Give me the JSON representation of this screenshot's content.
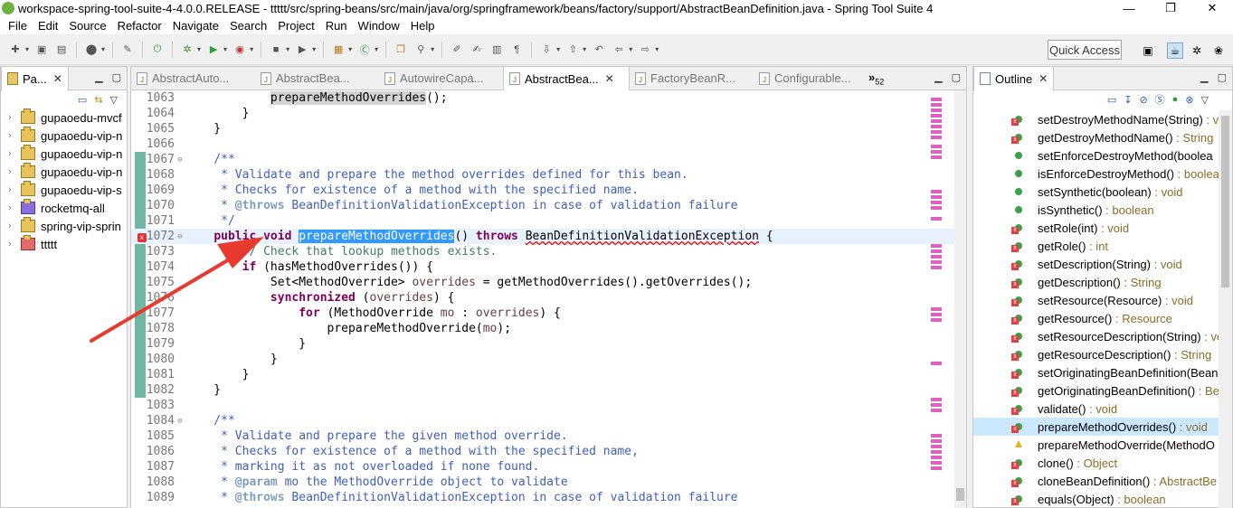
{
  "window": {
    "title": "workspace-spring-tool-suite-4-4.0.0.RELEASE - ttttt/src/spring-beans/src/main/java/org/springframework/beans/factory/support/AbstractBeanDefinition.java - Spring Tool Suite 4",
    "minimize": "—",
    "restore": "❐",
    "close": "✕"
  },
  "menu": [
    "File",
    "Edit",
    "Source",
    "Refactor",
    "Navigate",
    "Search",
    "Project",
    "Run",
    "Window",
    "Help"
  ],
  "toolbar": {
    "quick_access": "Quick Access"
  },
  "package_explorer": {
    "tab_label": "Pa...",
    "projects": [
      "gupaoedu-mvcf",
      "gupaoedu-vip-n",
      "gupaoedu-vip-n",
      "gupaoedu-vip-n",
      "gupaoedu-vip-s",
      "rocketmq-all",
      "spring-vip-sprin",
      "ttttt"
    ]
  },
  "editor": {
    "tabs": [
      {
        "label": "AbstractAuto...",
        "active": false
      },
      {
        "label": "AbstractBea...",
        "active": false
      },
      {
        "label": "AutowireCapa...",
        "active": false
      },
      {
        "label": "AbstractBea...",
        "active": true
      },
      {
        "label": "FactoryBeanR...",
        "active": false
      },
      {
        "label": "Configurable...",
        "active": false
      }
    ],
    "overflow_count": "52",
    "lines": [
      {
        "n": "1063",
        "text": "            prepareMethodOverrides();"
      },
      {
        "n": "1064",
        "text": "        }"
      },
      {
        "n": "1065",
        "text": "    }"
      },
      {
        "n": "1066",
        "text": ""
      },
      {
        "n": "1067",
        "text": "    /**"
      },
      {
        "n": "1068",
        "text": "     * Validate and prepare the method overrides defined for this bean."
      },
      {
        "n": "1069",
        "text": "     * Checks for existence of a method with the specified name."
      },
      {
        "n": "1070",
        "text": "     * @throws BeanDefinitionValidationException in case of validation failure"
      },
      {
        "n": "1071",
        "text": "     */"
      },
      {
        "n": "1072",
        "text": "    public void prepareMethodOverrides() throws BeanDefinitionValidationException {"
      },
      {
        "n": "1073",
        "text": "        // Check that lookup methods exists."
      },
      {
        "n": "1074",
        "text": "        if (hasMethodOverrides()) {"
      },
      {
        "n": "1075",
        "text": "            Set<MethodOverride> overrides = getMethodOverrides().getOverrides();"
      },
      {
        "n": "1076",
        "text": "            synchronized (overrides) {"
      },
      {
        "n": "1077",
        "text": "                for (MethodOverride mo : overrides) {"
      },
      {
        "n": "1078",
        "text": "                    prepareMethodOverride(mo);"
      },
      {
        "n": "1079",
        "text": "                }"
      },
      {
        "n": "1080",
        "text": "            }"
      },
      {
        "n": "1081",
        "text": "        }"
      },
      {
        "n": "1082",
        "text": "    }"
      },
      {
        "n": "1083",
        "text": ""
      },
      {
        "n": "1084",
        "text": "    /**"
      },
      {
        "n": "1085",
        "text": "     * Validate and prepare the given method override."
      },
      {
        "n": "1086",
        "text": "     * Checks for existence of a method with the specified name,"
      },
      {
        "n": "1087",
        "text": "     * marking it as not overloaded if none found."
      },
      {
        "n": "1088",
        "text": "     * @param mo the MethodOverride object to validate"
      },
      {
        "n": "1089",
        "text": "     * @throws BeanDefinitionValidationException in case of validation failure"
      }
    ]
  },
  "outline": {
    "tab_label": "Outline",
    "items": [
      {
        "name": "setDestroyMethodName(String)",
        "type": " : v",
        "icon": "err"
      },
      {
        "name": "getDestroyMethodName()",
        "type": " : String",
        "icon": "err"
      },
      {
        "name": "setEnforceDestroyMethod(boolea",
        "type": "",
        "icon": "dot"
      },
      {
        "name": "isEnforceDestroyMethod()",
        "type": " : boolea",
        "icon": "dot"
      },
      {
        "name": "setSynthetic(boolean)",
        "type": " : void",
        "icon": "dot"
      },
      {
        "name": "isSynthetic()",
        "type": " : boolean",
        "icon": "dot"
      },
      {
        "name": "setRole(int)",
        "type": " : void",
        "icon": "err"
      },
      {
        "name": "getRole()",
        "type": " : int",
        "icon": "err"
      },
      {
        "name": "setDescription(String)",
        "type": " : void",
        "icon": "err"
      },
      {
        "name": "getDescription()",
        "type": " : String",
        "icon": "err"
      },
      {
        "name": "setResource(Resource)",
        "type": " : void",
        "icon": "err"
      },
      {
        "name": "getResource()",
        "type": " : Resource",
        "icon": "err"
      },
      {
        "name": "setResourceDescription(String)",
        "type": " : voi",
        "icon": "err"
      },
      {
        "name": "getResourceDescription()",
        "type": " : String",
        "icon": "err"
      },
      {
        "name": "setOriginatingBeanDefinition(Bean",
        "type": "",
        "icon": "err"
      },
      {
        "name": "getOriginatingBeanDefinition()",
        "type": " : Be",
        "icon": "err"
      },
      {
        "name": "validate()",
        "type": " : void",
        "icon": "err"
      },
      {
        "name": "prepareMethodOverrides()",
        "type": " : void",
        "icon": "err",
        "selected": true
      },
      {
        "name": "prepareMethodOverride(MethodO",
        "type": "",
        "icon": "warn"
      },
      {
        "name": "clone()",
        "type": " : Object",
        "icon": "err"
      },
      {
        "name": "cloneBeanDefinition()",
        "type": " : AbstractBe",
        "icon": "err"
      },
      {
        "name": "equals(Object)",
        "type": " : boolean",
        "icon": "err"
      }
    ]
  },
  "colors": {
    "keyword": "#7f0055",
    "javadoc": "#3f5fbf",
    "line_comment": "#3f7f5f",
    "selection": "#3399ff",
    "annotation_arrow": "#e83a2f"
  }
}
